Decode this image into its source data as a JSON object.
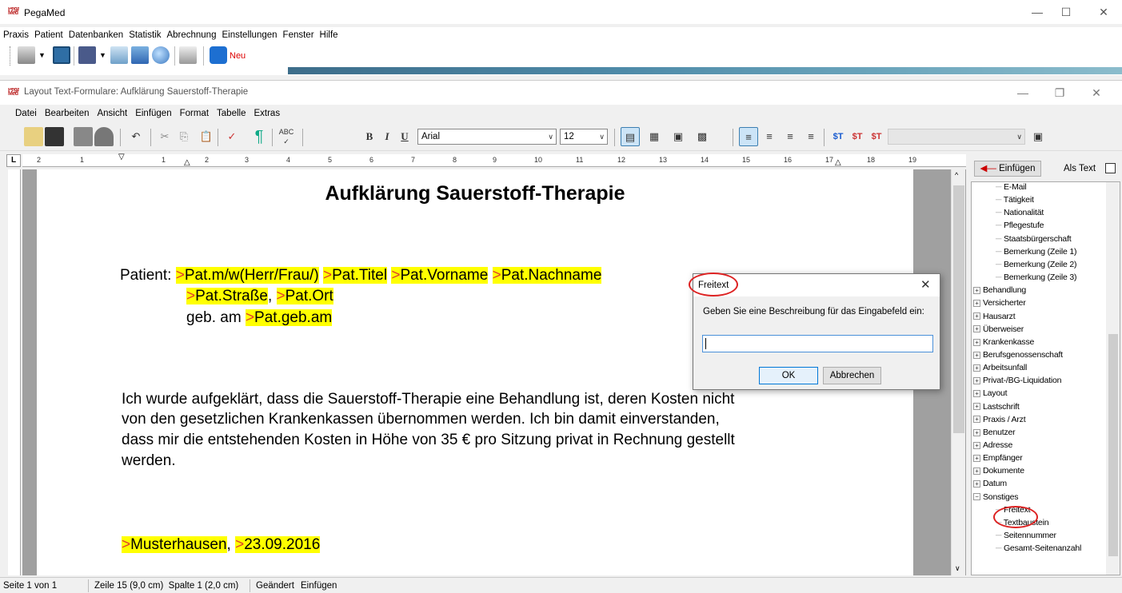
{
  "outer_window": {
    "title": "PegaMed",
    "icon_text": "Pega Med",
    "menu": [
      "Praxis",
      "Patient",
      "Datenbanken",
      "Statistik",
      "Abrechnung",
      "Einstellungen",
      "Fenster",
      "Hilfe"
    ],
    "toolbar_new_label": "Neu"
  },
  "inner_window": {
    "title": "Layout Text-Formulare: Aufklärung Sauerstoff-Therapie",
    "menu": [
      "Datei",
      "Bearbeiten",
      "Ansicht",
      "Einfügen",
      "Format",
      "Tabelle",
      "Extras"
    ],
    "font_name": "Arial",
    "font_size": "12",
    "ruler_numbers": [
      "2",
      "1",
      "1",
      "2",
      "3",
      "4",
      "5",
      "6",
      "7",
      "8",
      "9",
      "10",
      "11",
      "12",
      "13",
      "14",
      "15",
      "16",
      "17",
      "18",
      "19"
    ]
  },
  "document": {
    "title": "Aufklärung Sauerstoff-Therapie",
    "patient_label": "Patient:",
    "f_anrede": "Pat.m/w(Herr/Frau/)",
    "f_titel": "Pat.Titel",
    "f_vorname": "Pat.Vorname",
    "f_nachname": "Pat.Nachname",
    "f_strasse": "Pat.Straße",
    "comma": ",",
    "f_ort": "Pat.Ort",
    "geb_label": "geb. am",
    "f_gebam": "Pat.geb.am",
    "marker": ">",
    "body_lines": [
      "Ich wurde aufgeklärt, dass die Sauerstoff-Therapie eine Behandlung ist, deren Kosten nicht",
      "von den gesetzlichen Krankenkassen übernommen werden. Ich bin damit einverstanden,",
      "dass mir die entstehenden Kosten in Höhe von 35 € pro Sitzung privat in Rechnung gestellt",
      "werden."
    ],
    "place": "Musterhausen",
    "date": "23.09.2016"
  },
  "right_panel": {
    "insert_button": "Einfügen",
    "als_text_label": "Als Text",
    "als_text_checked": false,
    "tree_items": [
      {
        "label": "E-Mail",
        "level": 2,
        "type": "leaf"
      },
      {
        "label": "Tätigkeit",
        "level": 2,
        "type": "leaf"
      },
      {
        "label": "Nationalität",
        "level": 2,
        "type": "leaf"
      },
      {
        "label": "Pflegestufe",
        "level": 2,
        "type": "leaf"
      },
      {
        "label": "Staatsbürgerschaft",
        "level": 2,
        "type": "leaf"
      },
      {
        "label": "Bemerkung (Zeile 1)",
        "level": 2,
        "type": "leaf"
      },
      {
        "label": "Bemerkung (Zeile 2)",
        "level": 2,
        "type": "leaf"
      },
      {
        "label": "Bemerkung (Zeile 3)",
        "level": 2,
        "type": "leaf"
      },
      {
        "label": "Behandlung",
        "level": 1,
        "type": "collapsed"
      },
      {
        "label": "Versicherter",
        "level": 1,
        "type": "collapsed"
      },
      {
        "label": "Hausarzt",
        "level": 1,
        "type": "collapsed"
      },
      {
        "label": "Überweiser",
        "level": 1,
        "type": "collapsed"
      },
      {
        "label": "Krankenkasse",
        "level": 1,
        "type": "collapsed"
      },
      {
        "label": "Berufsgenossenschaft",
        "level": 1,
        "type": "collapsed"
      },
      {
        "label": "Arbeitsunfall",
        "level": 1,
        "type": "collapsed"
      },
      {
        "label": "Privat-/BG-Liquidation",
        "level": 1,
        "type": "collapsed"
      },
      {
        "label": "Layout",
        "level": 1,
        "type": "collapsed"
      },
      {
        "label": "Lastschrift",
        "level": 1,
        "type": "collapsed"
      },
      {
        "label": "Praxis / Arzt",
        "level": 1,
        "type": "collapsed"
      },
      {
        "label": "Benutzer",
        "level": 1,
        "type": "collapsed"
      },
      {
        "label": "Adresse",
        "level": 1,
        "type": "collapsed"
      },
      {
        "label": "Empfänger",
        "level": 1,
        "type": "collapsed"
      },
      {
        "label": "Dokumente",
        "level": 1,
        "type": "collapsed"
      },
      {
        "label": "Datum",
        "level": 1,
        "type": "collapsed"
      },
      {
        "label": "Sonstiges",
        "level": 1,
        "type": "expanded"
      },
      {
        "label": "Freitext",
        "level": 2,
        "type": "leaf",
        "highlighted": true
      },
      {
        "label": "Textbaustein",
        "level": 2,
        "type": "leaf"
      },
      {
        "label": "Seitennummer",
        "level": 2,
        "type": "leaf"
      },
      {
        "label": "Gesamt-Seitenanzahl",
        "level": 2,
        "type": "leaf"
      }
    ]
  },
  "status_bar": {
    "page": "Seite 1 von 1",
    "position": "Zeile 15 (9,0 cm)  Spalte 1 (2,0 cm)",
    "changed": "Geändert",
    "mode": "Einfügen"
  },
  "dialog": {
    "title": "Freitext",
    "description": "Geben Sie eine Beschreibung für das Eingabefeld ein:",
    "input_value": "",
    "ok_label": "OK",
    "cancel_label": "Abbrechen"
  },
  "colors": {
    "field_highlight": "#ffff00",
    "field_marker": "#e0402a",
    "annotation_circle": "#d22222"
  }
}
